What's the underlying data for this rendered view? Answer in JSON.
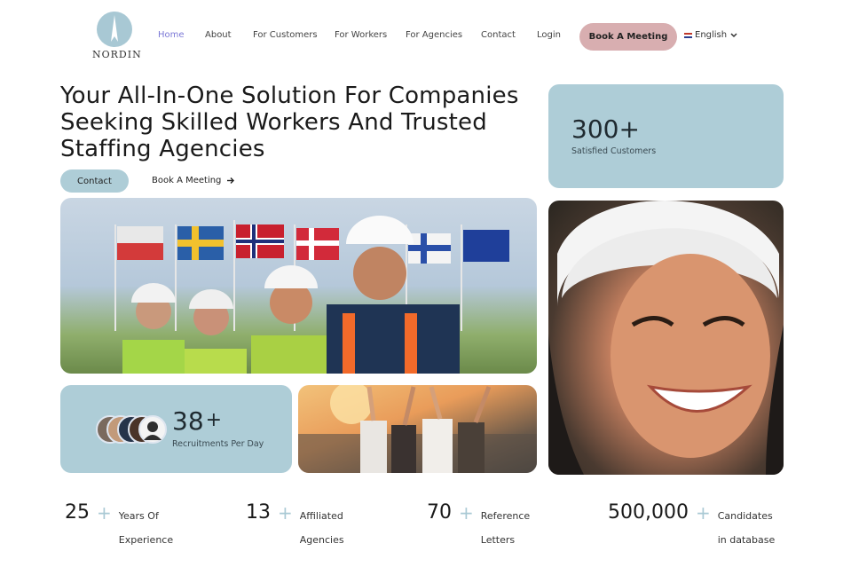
{
  "brand": {
    "name": "NORDIN"
  },
  "nav": {
    "items": [
      {
        "label": "Home",
        "active": true
      },
      {
        "label": "About"
      },
      {
        "label": "For Customers"
      },
      {
        "label": "For Workers"
      },
      {
        "label": "For Agencies"
      },
      {
        "label": "Contact"
      },
      {
        "label": "Login"
      }
    ],
    "cta": "Book A Meeting",
    "language": "English"
  },
  "hero": {
    "title": "Your All-In-One Solution For Companies Seeking Skilled Workers And Trusted Staffing Agencies",
    "contact_label": "Contact",
    "book_label": "Book A Meeting"
  },
  "cards": {
    "customers": {
      "value": "300+",
      "label": "Satisfied Customers"
    },
    "recruitments": {
      "value": "38",
      "plus": "+",
      "label": "Recruitments Per Day"
    }
  },
  "stats": [
    {
      "value": "25",
      "plus": "+",
      "line1": "Years Of",
      "line2": "Experience"
    },
    {
      "value": "13",
      "plus": "+",
      "line1": "Affiliated",
      "line2": "Agencies"
    },
    {
      "value": "70",
      "plus": "+",
      "line1": "Reference",
      "line2": "Letters"
    },
    {
      "value": "500,000",
      "plus": "+",
      "line1": "Candidates",
      "line2": "in database"
    }
  ],
  "colors": {
    "accent_blue": "#aecdd7",
    "accent_pink": "#d8aeb0",
    "nav_active": "#7b78d6"
  },
  "icons": [
    "nordin-compass-logo",
    "chevron-down-icon",
    "arrow-right-icon",
    "uk-flag-icon"
  ]
}
